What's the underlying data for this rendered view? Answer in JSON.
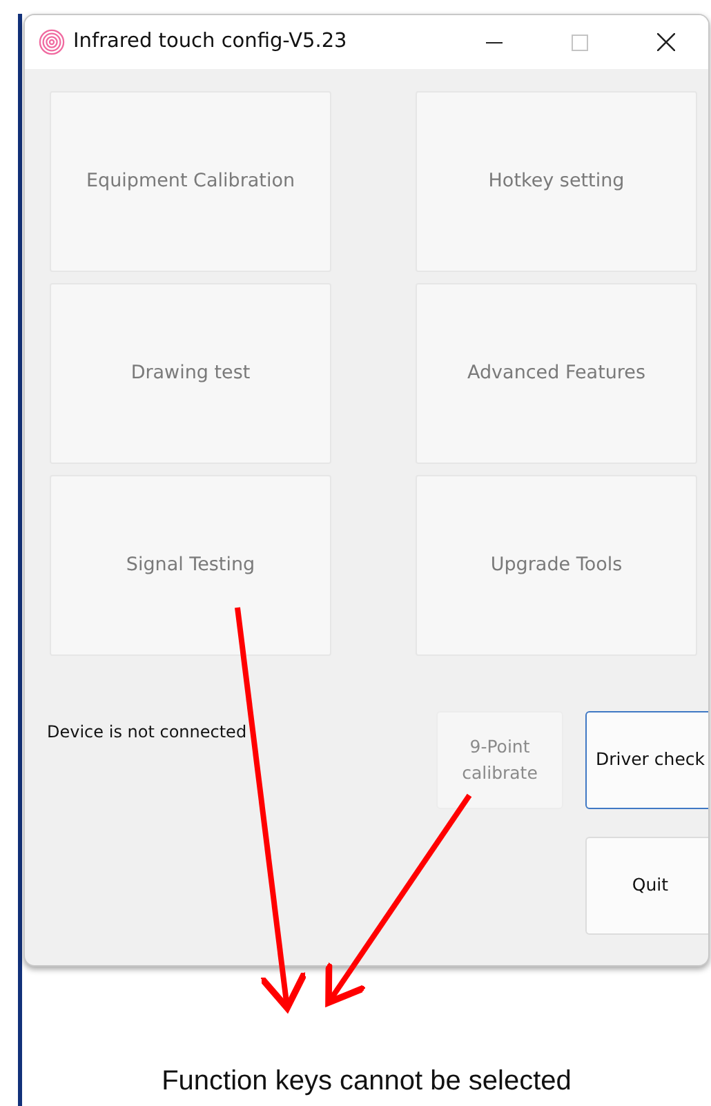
{
  "window": {
    "title": "Infrared touch config-V5.23",
    "controls": [
      {
        "kind": "minimize",
        "disabled": false
      },
      {
        "kind": "maximize",
        "disabled": true
      },
      {
        "kind": "close",
        "disabled": false
      }
    ]
  },
  "function_buttons": [
    {
      "label": "Equipment Calibration",
      "disabled": true
    },
    {
      "label": "Hotkey setting",
      "disabled": true
    },
    {
      "label": "Drawing test",
      "disabled": true
    },
    {
      "label": "Advanced Features",
      "disabled": true
    },
    {
      "label": "Signal Testing",
      "disabled": true
    },
    {
      "label": "Upgrade Tools",
      "disabled": true
    }
  ],
  "status_text": "Device is not connected",
  "action_buttons": [
    {
      "label": "9-Point calibrate",
      "disabled": true,
      "focused": false
    },
    {
      "label": "Driver check",
      "disabled": false,
      "focused": true
    },
    {
      "label": "Quit",
      "disabled": false,
      "focused": false
    }
  ],
  "caption": "Function keys cannot be selected"
}
